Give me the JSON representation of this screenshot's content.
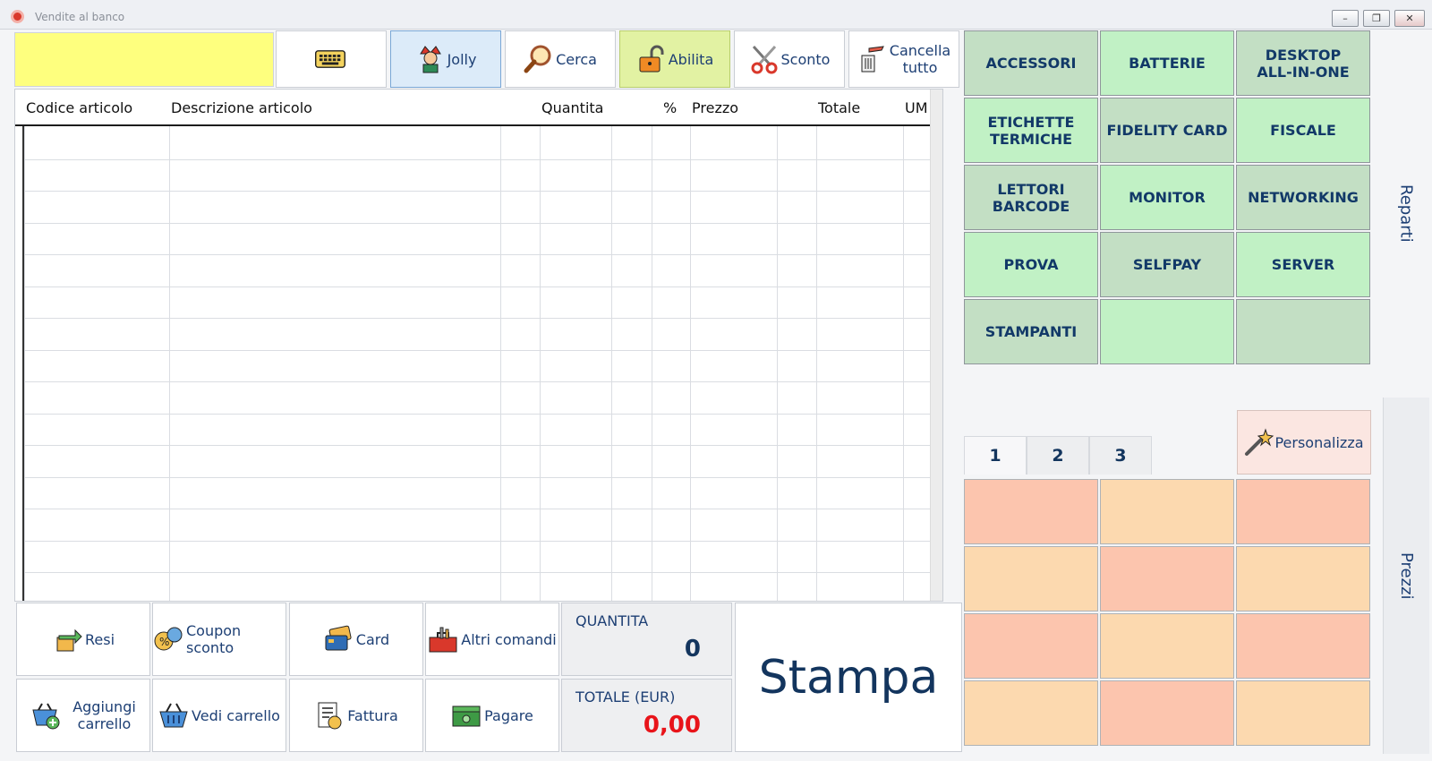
{
  "window": {
    "title": "Vendite al banco"
  },
  "input": {
    "value": ""
  },
  "toolbar": {
    "jolly": "Jolly",
    "cerca": "Cerca",
    "abilita": "Abilita",
    "sconto": "Sconto",
    "cancella_line1": "Cancella",
    "cancella_line2": "tutto"
  },
  "grid": {
    "columns": [
      "Codice articolo",
      "Descrizione articolo",
      "Quantita",
      "%",
      "Prezzo",
      "Totale",
      "UM"
    ]
  },
  "bottom": {
    "resi": "Resi",
    "coupon": "Coupon sconto",
    "card": "Card",
    "altri": "Altri comandi",
    "aggiungi_line1": "Aggiungi",
    "aggiungi_line2": "carrello",
    "vedi": "Vedi carrello",
    "fattura": "Fattura",
    "pagare": "Pagare",
    "stampa": "Stampa"
  },
  "summary": {
    "quantita_label": "QUANTITA",
    "quantita_value": "0",
    "totale_label": "TOTALE (EUR)",
    "totale_value": "0,00"
  },
  "departments": [
    [
      "ACCESSORI"
    ],
    [
      "BATTERIE"
    ],
    [
      "DESKTOP",
      "ALL-IN-ONE"
    ],
    [
      "ETICHETTE",
      "TERMICHE"
    ],
    [
      "FIDELITY CARD"
    ],
    [
      "FISCALE"
    ],
    [
      "LETTORI",
      "BARCODE"
    ],
    [
      "MONITOR"
    ],
    [
      "NETWORKING"
    ],
    [
      "PROVA"
    ],
    [
      "SELFPAY"
    ],
    [
      "SERVER"
    ],
    [
      "STAMPANTI"
    ],
    [
      ""
    ],
    [
      ""
    ]
  ],
  "side_tabs": {
    "reparti": "Reparti",
    "prezzi": "Prezzi"
  },
  "price_tabs": [
    "1",
    "2",
    "3"
  ],
  "personalizza": "Personalizza",
  "colors": {
    "input_bg": "#feff7e",
    "total_value": "#e8141a",
    "dept_a": "#c3dfc4",
    "dept_b": "#c1f1c5",
    "price_a": "#fcc5ae",
    "price_b": "#fcd9af"
  }
}
